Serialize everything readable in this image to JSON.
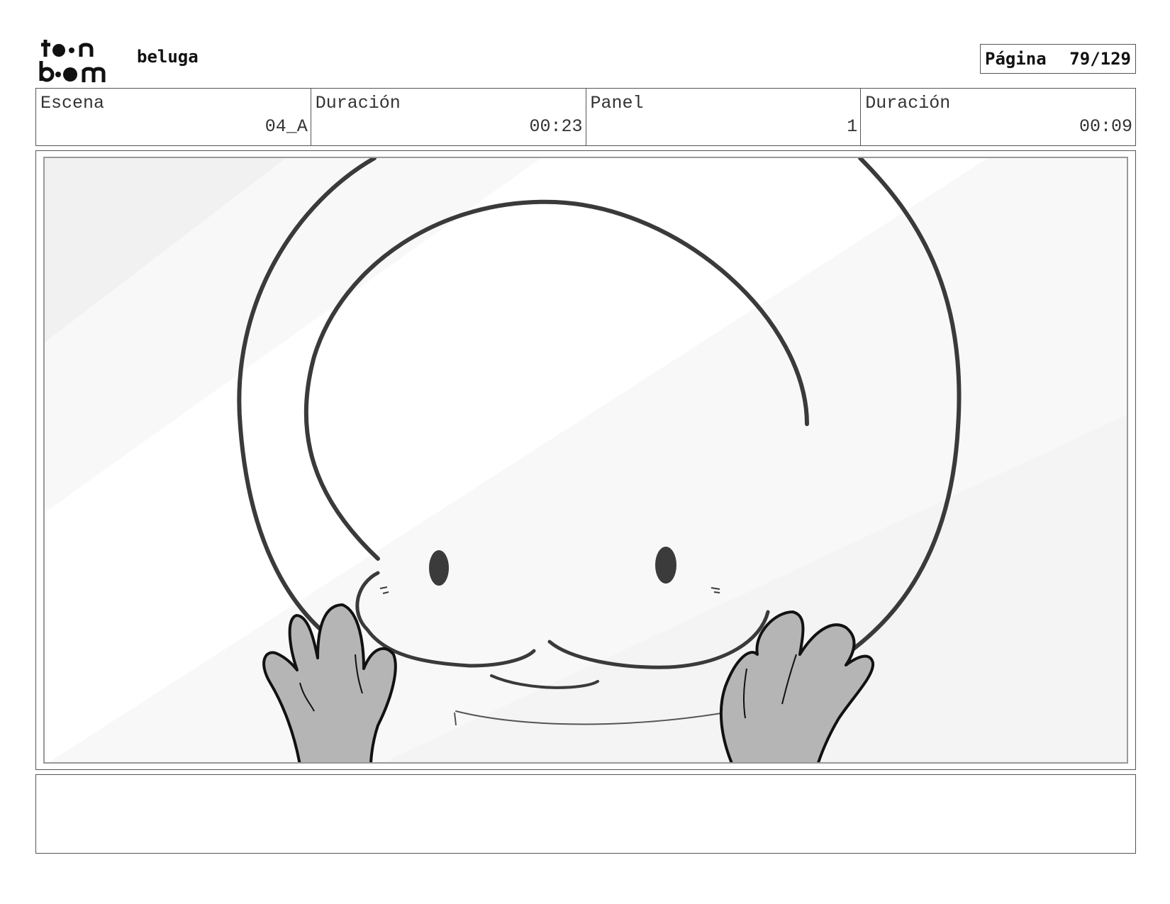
{
  "header": {
    "logo_text": "toon boom",
    "project_title": "beluga",
    "page_label": "Página",
    "page_number": "79/129"
  },
  "info": {
    "scene_label": "Escena",
    "scene_value": "04_A",
    "scene_duration_label": "Duración",
    "scene_duration_value": "00:23",
    "panel_label": "Panel",
    "panel_value": "1",
    "panel_duration_label": "Duración",
    "panel_duration_value": "00:09"
  },
  "notes": {
    "text": ""
  }
}
